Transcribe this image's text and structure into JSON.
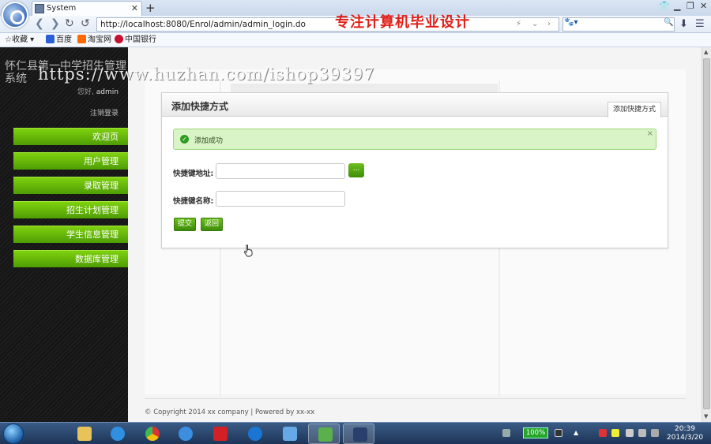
{
  "browser": {
    "tab_title": "System",
    "new_tab": "+",
    "url": "http://localhost:8080/Enrol/admin/admin_login.do",
    "overlay_title": "专注计算机毕业设计",
    "bookmarks": [
      "收藏",
      "百度",
      "淘宝网",
      "中国银行"
    ]
  },
  "sidebar": {
    "site_title": "怀仁县第一中学招生管理系统",
    "greeting": "您好,",
    "username": "admin",
    "logout": "注销登录",
    "menu": [
      "欢迎页",
      "用户管理",
      "录取管理",
      "招生计划管理",
      "学生信息管理",
      "数据库管理"
    ]
  },
  "panel": {
    "title": "添加快捷方式",
    "tab_label": "添加快捷方式",
    "alert": "添加成功",
    "alert_close": "×",
    "url_label": "快捷键地址:",
    "name_label": "快捷键名称:",
    "browse_label": "...",
    "submit_label": "提交",
    "back_label": "返回"
  },
  "footer": "© Copyright 2014 xx company | Powered by xx-xx",
  "watermark": "https://www.huzhan.com/ishop39397",
  "taskbar": {
    "battery": "100%",
    "time": "20:39",
    "date": "2014/3/20"
  },
  "colors": {
    "menu_green": "#5fb509",
    "alert_bg": "#d9f4c6",
    "overlay_red": "#e0201a"
  }
}
